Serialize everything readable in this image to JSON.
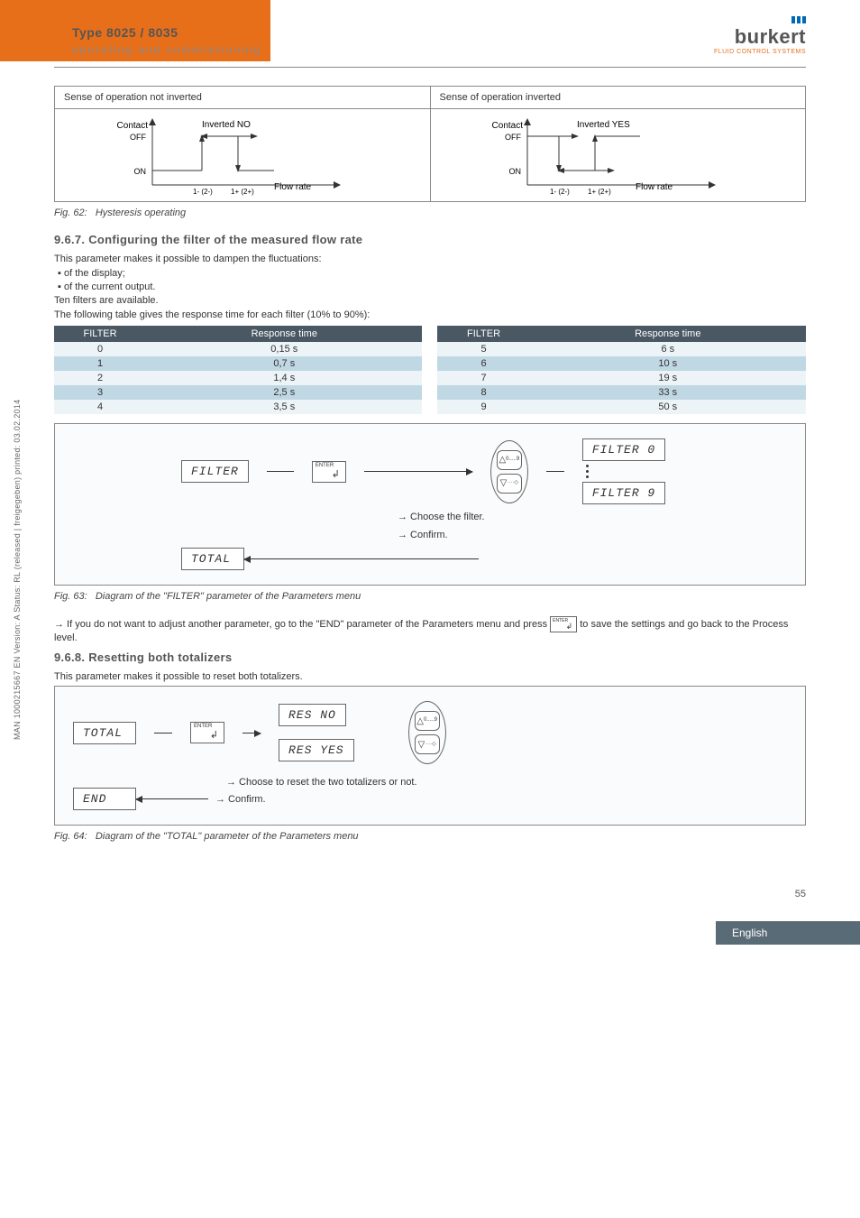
{
  "header": {
    "type_title": "Type 8025 / 8035",
    "subtitle": "operating and commissioning",
    "logo": "burkert",
    "logo_sub": "FLUID CONTROL SYSTEMS"
  },
  "hysteresis": {
    "col1_title": "Sense of operation not inverted",
    "col2_title": "Sense of operation inverted",
    "left": {
      "contact": "Contact",
      "inv": "Inverted NO",
      "off": "OFF",
      "on": "ON",
      "lo": "1- (2-)",
      "hi": "1+ (2+)",
      "flow": "Flow rate"
    },
    "right": {
      "contact": "Contact",
      "inv": "Inverted YES",
      "off": "OFF",
      "on": "ON",
      "lo": "1- (2-)",
      "hi": "1+ (2+)",
      "flow": "Flow rate"
    },
    "caption_no": "Fig. 62:",
    "caption_text": "Hysteresis operating"
  },
  "section967": {
    "title": "9.6.7.   Configuring the filter of the measured flow rate",
    "p1": "This parameter makes it possible to dampen the fluctuations:",
    "b1": "of the display;",
    "b2": "of the current output.",
    "p2": "Ten filters are available.",
    "p3": "The following table gives the response time for each filter (10% to 90%):"
  },
  "resp_table": {
    "h1": "FILTER",
    "h2": "Response time",
    "rows_left": [
      {
        "f": "0",
        "t": "0,15 s"
      },
      {
        "f": "1",
        "t": "0,7 s"
      },
      {
        "f": "2",
        "t": "1,4 s"
      },
      {
        "f": "3",
        "t": "2,5 s"
      },
      {
        "f": "4",
        "t": "3,5 s"
      }
    ],
    "rows_right": [
      {
        "f": "5",
        "t": "6 s"
      },
      {
        "f": "6",
        "t": "10 s"
      },
      {
        "f": "7",
        "t": "19 s"
      },
      {
        "f": "8",
        "t": "33 s"
      },
      {
        "f": "9",
        "t": "50 s"
      }
    ]
  },
  "filter_diagram": {
    "filter": "FILTER",
    "f0": "FILTER 0",
    "f9": "FILTER 9",
    "total": "TOTAL",
    "action1": "→ Choose the filter.",
    "action2": "→ Confirm."
  },
  "fig63": {
    "no": "Fig. 63:",
    "text": "Diagram of the \"FILTER\" parameter of the Parameters menu"
  },
  "save_note": {
    "pre": "→ If you do not want to adjust another parameter, go to the \"END\" parameter of the Parameters menu and press",
    "post": "to save the settings and go back to the Process level."
  },
  "section968": {
    "title": "9.6.8.   Resetting both totalizers",
    "p1": "This parameter makes it possible to reset both totalizers."
  },
  "total_diagram": {
    "total": "TOTAL",
    "resno": "RES NO",
    "resyes": "RES YES",
    "end": "END",
    "action1": "→ Choose to reset the two totalizers or not.",
    "action2": "→ Confirm."
  },
  "fig64": {
    "no": "Fig. 64:",
    "text": "Diagram of the \"TOTAL\" parameter of the Parameters menu"
  },
  "sidebar": "MAN 1000215667 EN Version: A Status: RL (released | freigegeben) printed: 03.02.2014",
  "page": "55",
  "footer": "English",
  "triangle_sub_up": "0.....9",
  "triangle_sub_down": "····◇"
}
